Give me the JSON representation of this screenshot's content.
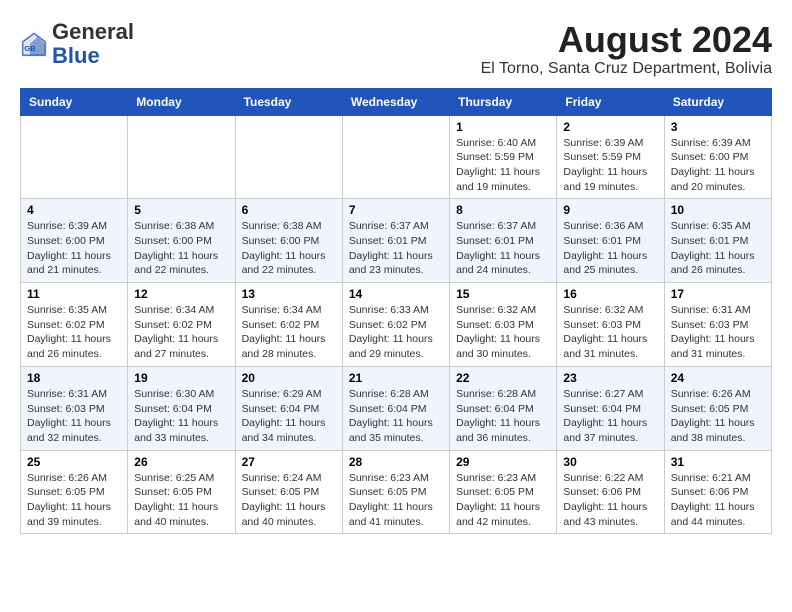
{
  "header": {
    "logo_general": "General",
    "logo_blue": "Blue",
    "month_year": "August 2024",
    "location": "El Torno, Santa Cruz Department, Bolivia"
  },
  "weekdays": [
    "Sunday",
    "Monday",
    "Tuesday",
    "Wednesday",
    "Thursday",
    "Friday",
    "Saturday"
  ],
  "weeks": [
    [
      {
        "day": "",
        "info": ""
      },
      {
        "day": "",
        "info": ""
      },
      {
        "day": "",
        "info": ""
      },
      {
        "day": "",
        "info": ""
      },
      {
        "day": "1",
        "info": "Sunrise: 6:40 AM\nSunset: 5:59 PM\nDaylight: 11 hours\nand 19 minutes."
      },
      {
        "day": "2",
        "info": "Sunrise: 6:39 AM\nSunset: 5:59 PM\nDaylight: 11 hours\nand 19 minutes."
      },
      {
        "day": "3",
        "info": "Sunrise: 6:39 AM\nSunset: 6:00 PM\nDaylight: 11 hours\nand 20 minutes."
      }
    ],
    [
      {
        "day": "4",
        "info": "Sunrise: 6:39 AM\nSunset: 6:00 PM\nDaylight: 11 hours\nand 21 minutes."
      },
      {
        "day": "5",
        "info": "Sunrise: 6:38 AM\nSunset: 6:00 PM\nDaylight: 11 hours\nand 22 minutes."
      },
      {
        "day": "6",
        "info": "Sunrise: 6:38 AM\nSunset: 6:00 PM\nDaylight: 11 hours\nand 22 minutes."
      },
      {
        "day": "7",
        "info": "Sunrise: 6:37 AM\nSunset: 6:01 PM\nDaylight: 11 hours\nand 23 minutes."
      },
      {
        "day": "8",
        "info": "Sunrise: 6:37 AM\nSunset: 6:01 PM\nDaylight: 11 hours\nand 24 minutes."
      },
      {
        "day": "9",
        "info": "Sunrise: 6:36 AM\nSunset: 6:01 PM\nDaylight: 11 hours\nand 25 minutes."
      },
      {
        "day": "10",
        "info": "Sunrise: 6:35 AM\nSunset: 6:01 PM\nDaylight: 11 hours\nand 26 minutes."
      }
    ],
    [
      {
        "day": "11",
        "info": "Sunrise: 6:35 AM\nSunset: 6:02 PM\nDaylight: 11 hours\nand 26 minutes."
      },
      {
        "day": "12",
        "info": "Sunrise: 6:34 AM\nSunset: 6:02 PM\nDaylight: 11 hours\nand 27 minutes."
      },
      {
        "day": "13",
        "info": "Sunrise: 6:34 AM\nSunset: 6:02 PM\nDaylight: 11 hours\nand 28 minutes."
      },
      {
        "day": "14",
        "info": "Sunrise: 6:33 AM\nSunset: 6:02 PM\nDaylight: 11 hours\nand 29 minutes."
      },
      {
        "day": "15",
        "info": "Sunrise: 6:32 AM\nSunset: 6:03 PM\nDaylight: 11 hours\nand 30 minutes."
      },
      {
        "day": "16",
        "info": "Sunrise: 6:32 AM\nSunset: 6:03 PM\nDaylight: 11 hours\nand 31 minutes."
      },
      {
        "day": "17",
        "info": "Sunrise: 6:31 AM\nSunset: 6:03 PM\nDaylight: 11 hours\nand 31 minutes."
      }
    ],
    [
      {
        "day": "18",
        "info": "Sunrise: 6:31 AM\nSunset: 6:03 PM\nDaylight: 11 hours\nand 32 minutes."
      },
      {
        "day": "19",
        "info": "Sunrise: 6:30 AM\nSunset: 6:04 PM\nDaylight: 11 hours\nand 33 minutes."
      },
      {
        "day": "20",
        "info": "Sunrise: 6:29 AM\nSunset: 6:04 PM\nDaylight: 11 hours\nand 34 minutes."
      },
      {
        "day": "21",
        "info": "Sunrise: 6:28 AM\nSunset: 6:04 PM\nDaylight: 11 hours\nand 35 minutes."
      },
      {
        "day": "22",
        "info": "Sunrise: 6:28 AM\nSunset: 6:04 PM\nDaylight: 11 hours\nand 36 minutes."
      },
      {
        "day": "23",
        "info": "Sunrise: 6:27 AM\nSunset: 6:04 PM\nDaylight: 11 hours\nand 37 minutes."
      },
      {
        "day": "24",
        "info": "Sunrise: 6:26 AM\nSunset: 6:05 PM\nDaylight: 11 hours\nand 38 minutes."
      }
    ],
    [
      {
        "day": "25",
        "info": "Sunrise: 6:26 AM\nSunset: 6:05 PM\nDaylight: 11 hours\nand 39 minutes."
      },
      {
        "day": "26",
        "info": "Sunrise: 6:25 AM\nSunset: 6:05 PM\nDaylight: 11 hours\nand 40 minutes."
      },
      {
        "day": "27",
        "info": "Sunrise: 6:24 AM\nSunset: 6:05 PM\nDaylight: 11 hours\nand 40 minutes."
      },
      {
        "day": "28",
        "info": "Sunrise: 6:23 AM\nSunset: 6:05 PM\nDaylight: 11 hours\nand 41 minutes."
      },
      {
        "day": "29",
        "info": "Sunrise: 6:23 AM\nSunset: 6:05 PM\nDaylight: 11 hours\nand 42 minutes."
      },
      {
        "day": "30",
        "info": "Sunrise: 6:22 AM\nSunset: 6:06 PM\nDaylight: 11 hours\nand 43 minutes."
      },
      {
        "day": "31",
        "info": "Sunrise: 6:21 AM\nSunset: 6:06 PM\nDaylight: 11 hours\nand 44 minutes."
      }
    ]
  ]
}
